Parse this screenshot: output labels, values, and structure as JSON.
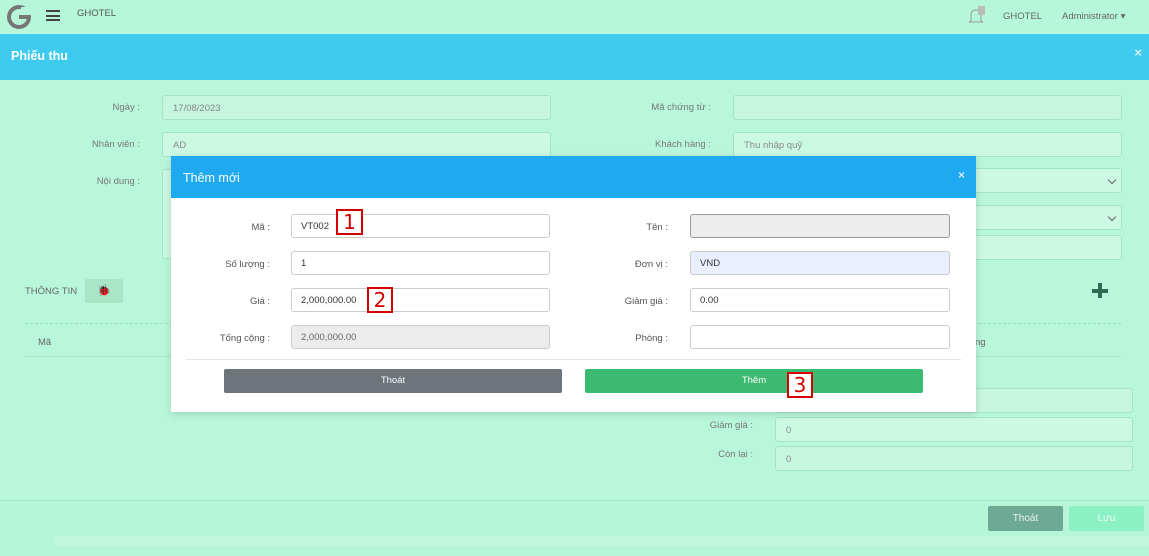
{
  "topbar": {
    "brand": "GHOTEL",
    "hotel": "GHOTEL",
    "user": "Administrator ▾",
    "notification_count": "0"
  },
  "page": {
    "title": "Phiếu thu",
    "close": "×"
  },
  "form": {
    "ngay_label": "Ngày :",
    "ngay_value": "17/08/2023",
    "nhanvien_label": "Nhân viên :",
    "nhanvien_value": "AD",
    "noidung_label": "Nội dung :",
    "machungtu_label": "Mã chứng từ :",
    "machungtu_value": "",
    "khachhang_label": "Khách hàng :",
    "khachhang_value": "Thu nhập quỹ"
  },
  "section": {
    "title": "THÔNG TIN",
    "bug_icon": "🐞"
  },
  "table": {
    "col_ma": "Mã",
    "col_right": "ng"
  },
  "totals": {
    "giamgia_label": "Giảm giá :",
    "giamgia_value": "0",
    "conlai_label": "Còn lại :",
    "conlai_value": "0"
  },
  "bottom": {
    "exit_label": "Thoát",
    "save_label": "Lưu"
  },
  "modal": {
    "title": "Thêm mới",
    "close": "×",
    "ma_label": "Mã :",
    "ma_value": "VT002",
    "ten_label": "Tên :",
    "ten_value": "",
    "soluong_label": "Số lượng :",
    "soluong_value": "1",
    "donvi_label": "Đơn vị :",
    "donvi_value": "VND",
    "gia_label": "Giá :",
    "gia_value": "2,000,000.00",
    "giamgia_label": "Giảm giá :",
    "giamgia_value": "0.00",
    "tongcong_label": "Tổng cộng :",
    "tongcong_value": "2,000,000.00",
    "phong_label": "Phòng :",
    "phong_value": "",
    "exit_label": "Thoát",
    "add_label": "Thêm"
  },
  "markers": [
    "1",
    "2",
    "3"
  ],
  "colors": {
    "header": "#3ecbef",
    "modal_header": "#1fa9f0",
    "add": "#3cba71",
    "marker": "#d40000"
  }
}
